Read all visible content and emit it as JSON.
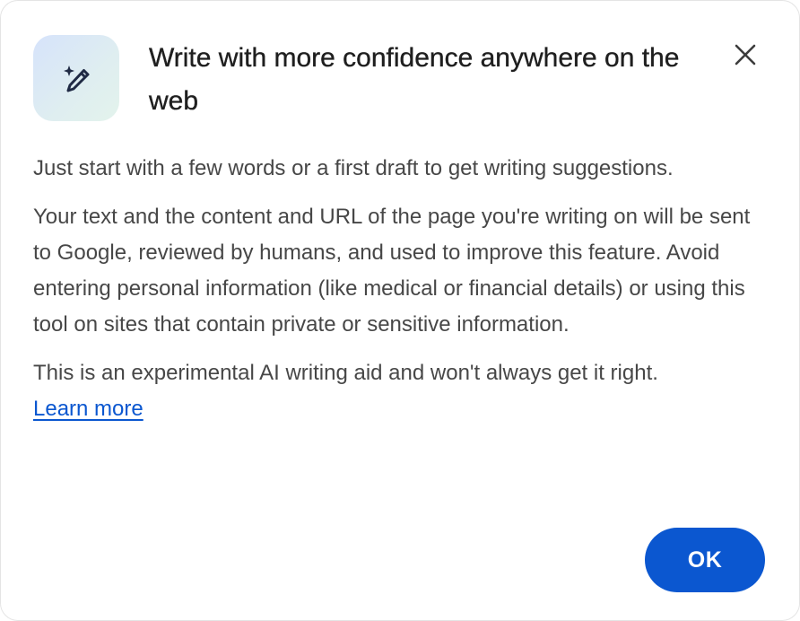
{
  "dialog": {
    "icon": "sparkle-pen-icon",
    "title": "Write with more confidence anywhere on the web",
    "close_icon": "close-icon",
    "paragraphs": [
      "Just start with a few words or a first draft to get writing suggestions.",
      "Your text and the content and URL of the page you're writing on will be sent to Google, reviewed by humans, and used to improve this feature. Avoid entering personal information (like medical or financial details) or using this tool on sites that contain private or sensitive information.",
      "This is an experimental AI writing aid and won't always get it right."
    ],
    "learn_more_label": "Learn more",
    "ok_label": "OK"
  },
  "colors": {
    "accent": "#0b57d0",
    "title_text": "#1f1f1f",
    "body_text": "#474747",
    "icon_tile_start": "#d6e3fb",
    "icon_tile_end": "#e3f3ec"
  }
}
